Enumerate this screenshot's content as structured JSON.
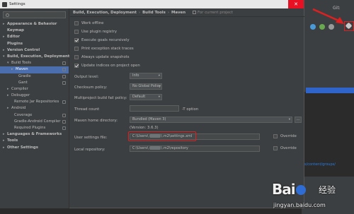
{
  "window": {
    "title": "Settings",
    "close": "✕"
  },
  "search": {
    "placeholder": ""
  },
  "tree": [
    {
      "label": "Appearance & Behavior",
      "arrow": "▸",
      "bold": true
    },
    {
      "label": "Keymap",
      "arrow": "",
      "bold": true
    },
    {
      "label": "Editor",
      "arrow": "▸",
      "bold": true
    },
    {
      "label": "Plugins",
      "arrow": "",
      "bold": true
    },
    {
      "label": "Version Control",
      "arrow": "▸",
      "bold": true
    },
    {
      "label": "Build, Execution, Deployment",
      "arrow": "▾",
      "bold": true
    },
    {
      "label": "Build Tools",
      "arrow": "▾",
      "bold": false
    },
    {
      "label": "Maven",
      "arrow": "▸",
      "bold": false
    },
    {
      "label": "Gradle",
      "arrow": "",
      "bold": false
    },
    {
      "label": "Gant",
      "arrow": "",
      "bold": false
    },
    {
      "label": "Compiler",
      "arrow": "▸",
      "bold": false
    },
    {
      "label": "Debugger",
      "arrow": "▸",
      "bold": false
    },
    {
      "label": "Remote Jar Repositories",
      "arrow": "",
      "bold": false
    },
    {
      "label": "Android",
      "arrow": "▸",
      "bold": false
    },
    {
      "label": "Coverage",
      "arrow": "",
      "bold": false
    },
    {
      "label": "Gradle-Android Compiler",
      "arrow": "",
      "bold": false
    },
    {
      "label": "Required Plugins",
      "arrow": "",
      "bold": false
    },
    {
      "label": "Languages & Frameworks",
      "arrow": "▸",
      "bold": true
    },
    {
      "label": "Tools",
      "arrow": "▸",
      "bold": true
    },
    {
      "label": "Other Settings",
      "arrow": "▸",
      "bold": true
    }
  ],
  "breadcrumb": {
    "part1": "Build, Execution, Deployment",
    "sep1": "›",
    "part2": "Build Tools",
    "sep2": "›",
    "part3": "Maven",
    "scope": "For current project"
  },
  "options": {
    "work_offline": "Work offline",
    "use_plugin_registry": "Use plugin registry",
    "execute_goals_recursively": "Execute goals recursively",
    "print_exception_stack_traces": "Print exception stack traces",
    "always_update_snapshots": "Always update snapshots",
    "update_indices": "Update indices on project open"
  },
  "fields": {
    "output_level_label": "Output level:",
    "output_level_value": "Info",
    "checksum_label": "Checksum policy:",
    "checksum_value": "No Global Policy",
    "multiproject_label": "Multiproject build fail policy:",
    "multiproject_value": "Default",
    "thread_count_label": "Thread count",
    "thread_count_value": "",
    "thread_count_hint": "-T option",
    "maven_home_label": "Maven home directory:",
    "maven_home_value": "Bundled (Maven 3)",
    "version": "(Version: 3.6.3)",
    "user_settings_label": "User settings file:",
    "user_settings_prefix": "C:\\Users\\",
    "user_settings_suffix": "\\.m2\\settings.xml",
    "local_repo_label": "Local repository:",
    "local_repo_prefix": "C:\\Users\\",
    "local_repo_suffix": "\\.m2\\repository",
    "override": "Override",
    "browse": "...",
    "dropdown": "▾"
  },
  "ide": {
    "git_label": "Git:",
    "link_text": "s/content/groups/"
  },
  "watermark": {
    "logo_left": "Bai",
    "logo_right": "经验",
    "url": "jingyan.baidu.com"
  }
}
